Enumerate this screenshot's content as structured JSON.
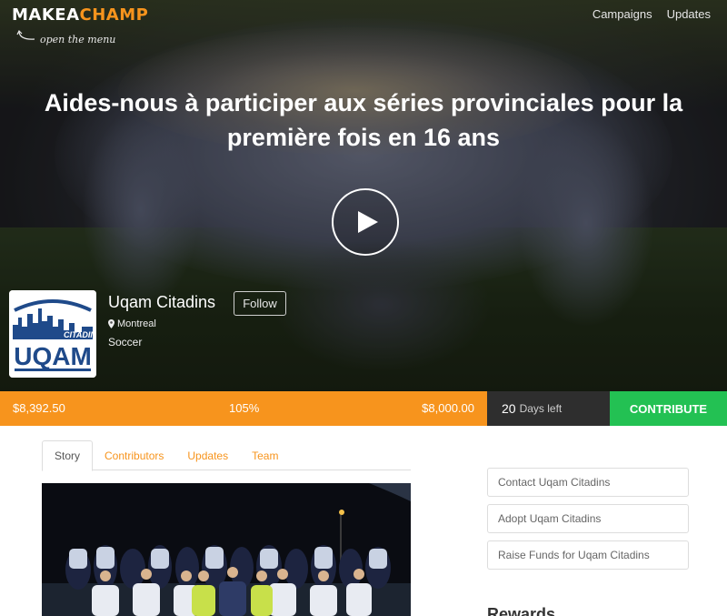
{
  "brand": {
    "part1": "MAKEA",
    "part2": "CHAMP",
    "accent_color": "#f7941d"
  },
  "menu_hint": "open the menu",
  "topnav": [
    "Campaigns",
    "Updates"
  ],
  "hero": {
    "title": "Aides-nous à participer aux séries provinciales pour la première fois en 16 ans"
  },
  "team": {
    "name": "Uqam Citadins",
    "follow_label": "Follow",
    "location": "Montreal",
    "sport": "Soccer",
    "logo_text_top": "CITADINS",
    "logo_text_main": "UQAM"
  },
  "funding": {
    "raised": "$8,392.50",
    "percent": "105%",
    "goal": "$8,000.00",
    "days_num": "20",
    "days_label": "Days left",
    "contribute_label": "CONTRIBUTE",
    "bar_color": "#f7941d",
    "contribute_color": "#23c153"
  },
  "tabs": [
    "Story",
    "Contributors",
    "Updates",
    "Team"
  ],
  "sidebar": {
    "buttons": [
      "Contact Uqam Citadins",
      "Adopt Uqam Citadins",
      "Raise Funds for Uqam Citadins"
    ],
    "rewards_heading": "Rewards"
  }
}
